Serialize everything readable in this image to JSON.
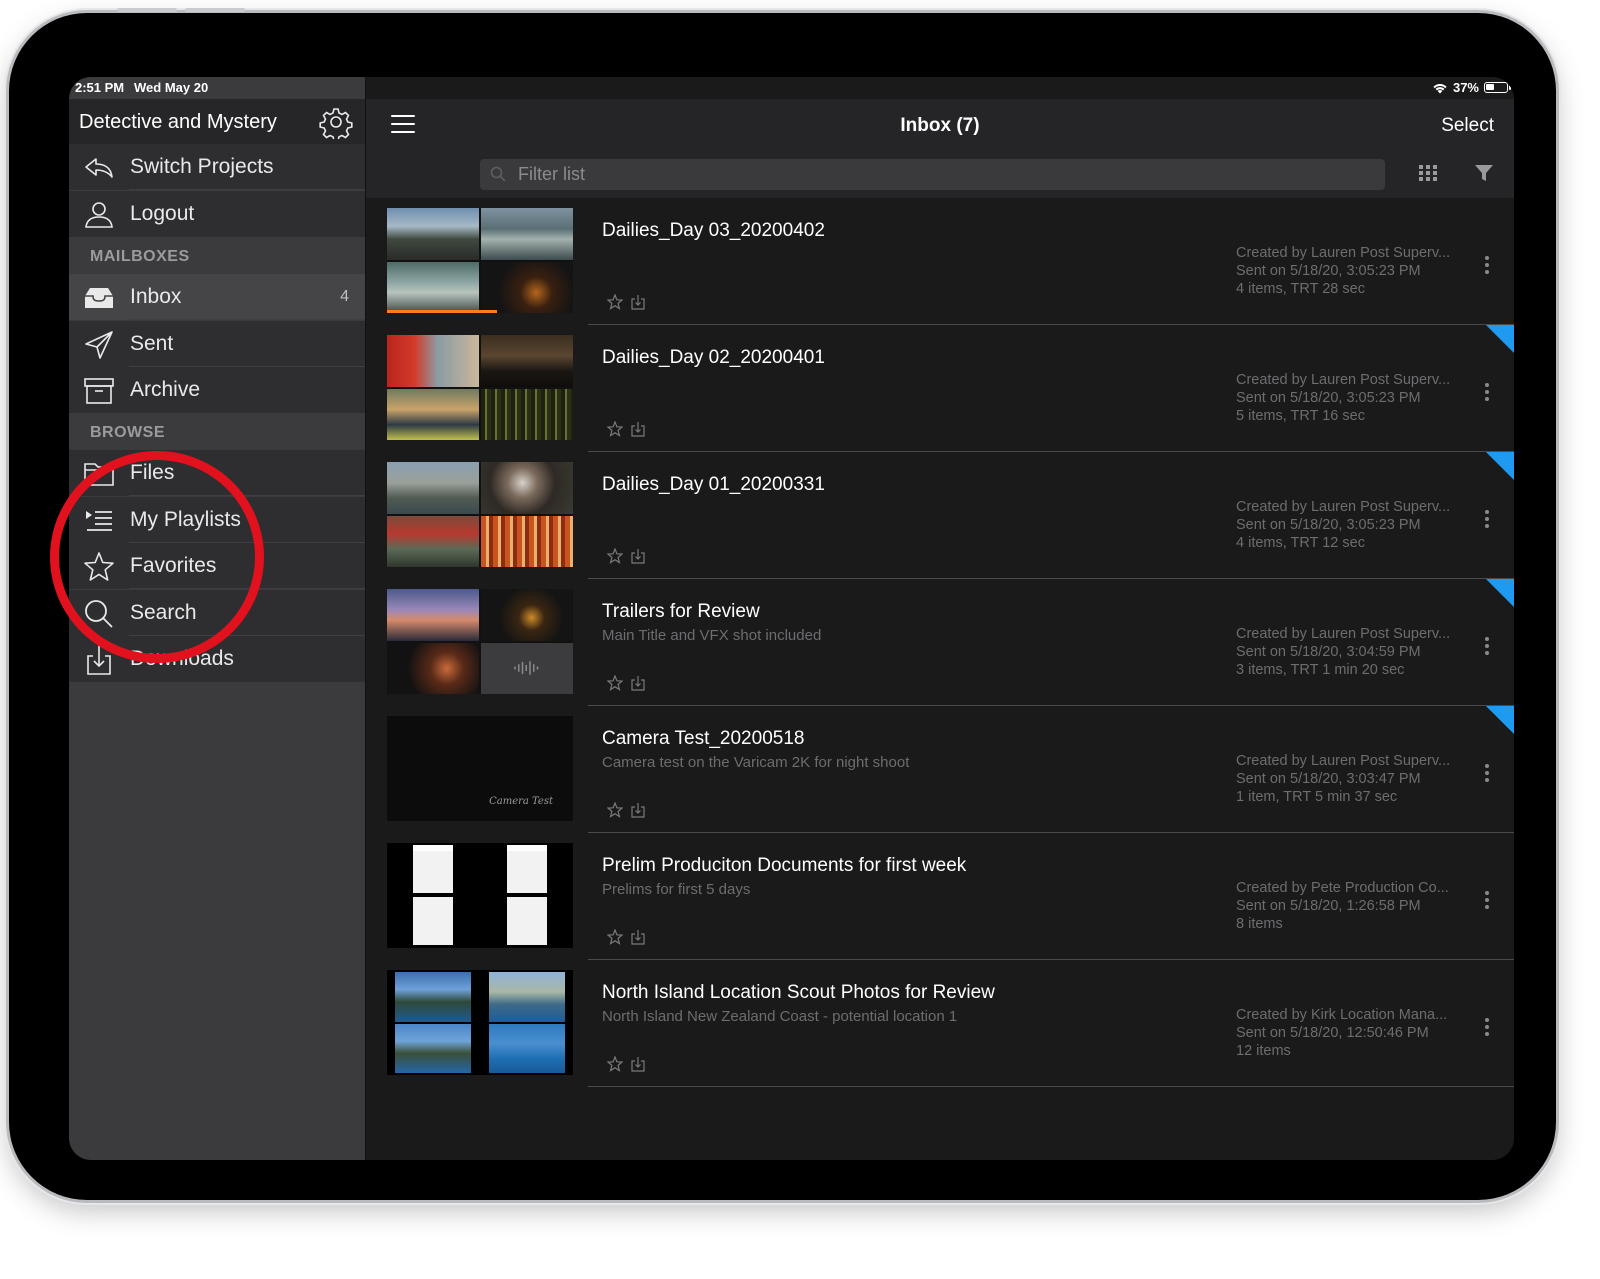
{
  "status": {
    "time": "2:51 PM",
    "date": "Wed May 20",
    "battery": "37%"
  },
  "sidebar": {
    "project_title": "Detective and Mystery",
    "top_items": [
      {
        "label": "Switch Projects",
        "icon": "reply-arrow-icon"
      },
      {
        "label": "Logout",
        "icon": "person-icon"
      }
    ],
    "sections": {
      "mailboxes": "MAILBOXES",
      "browse": "BROWSE"
    },
    "mailboxes": [
      {
        "label": "Inbox",
        "icon": "tray-icon",
        "count": "4"
      },
      {
        "label": "Sent",
        "icon": "paper-plane-icon"
      },
      {
        "label": "Archive",
        "icon": "archive-box-icon"
      }
    ],
    "browse": [
      {
        "label": "Files",
        "icon": "folder-icon"
      },
      {
        "label": "My Playlists",
        "icon": "playlist-icon"
      },
      {
        "label": "Favorites",
        "icon": "star-icon"
      },
      {
        "label": "Search",
        "icon": "magnifier-icon"
      },
      {
        "label": "Downloads",
        "icon": "download-icon"
      }
    ]
  },
  "header": {
    "title": "Inbox (7)",
    "select_label": "Select"
  },
  "filter": {
    "placeholder": "Filter list"
  },
  "colors": {
    "accent_flag": "#1e9bf0",
    "annotation": "#e1111e",
    "progress": "#ff7a1a"
  },
  "items": [
    {
      "name": "Dailies_Day 03_20200402",
      "description": "",
      "created": "Created by Lauren Post Superv...",
      "sent": "Sent on 5/18/20, 3:05:23 PM",
      "summary": "4 items, TRT 28 sec",
      "unread": false,
      "progress": 0.59
    },
    {
      "name": "Dailies_Day 02_20200401",
      "description": "",
      "created": "Created by Lauren Post Superv...",
      "sent": "Sent on 5/18/20, 3:05:23 PM",
      "summary": "5 items, TRT 16 sec",
      "unread": true
    },
    {
      "name": "Dailies_Day 01_20200331",
      "description": "",
      "created": "Created by Lauren Post Superv...",
      "sent": "Sent on 5/18/20, 3:05:23 PM",
      "summary": "4 items, TRT 12 sec",
      "unread": true
    },
    {
      "name": "Trailers for Review",
      "description": "Main Title and VFX shot included",
      "created": "Created by Lauren Post Superv...",
      "sent": "Sent on 5/18/20, 3:04:59 PM",
      "summary": "3 items, TRT 1 min 20 sec",
      "unread": true
    },
    {
      "name": "Camera Test_20200518",
      "description": "Camera test on the Varicam 2K for night shoot",
      "created": "Created by Lauren Post Superv...",
      "sent": "Sent on 5/18/20, 3:03:47 PM",
      "summary": "1 item, TRT 5 min 37 sec",
      "unread": true,
      "thumb_caption": "Camera Test"
    },
    {
      "name": "Prelim Produciton Documents for first week",
      "description": "Prelims for first 5 days",
      "created": "Created by Pete Production Co...",
      "sent": "Sent on 5/18/20, 1:26:58 PM",
      "summary": "8 items",
      "unread": false
    },
    {
      "name": "North Island Location Scout Photos for Review",
      "description": "North Island New Zealand Coast - potential location 1",
      "created": "Created by Kirk Location Mana...",
      "sent": "Sent on 5/18/20, 12:50:46 PM",
      "summary": "12 items",
      "unread": false
    }
  ]
}
